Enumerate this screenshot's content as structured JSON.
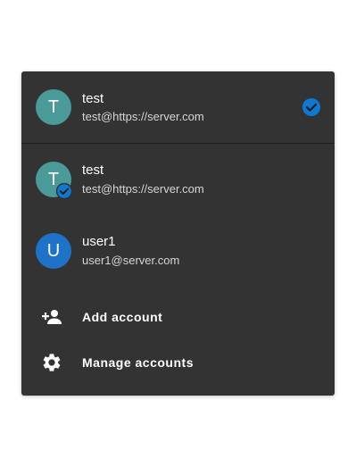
{
  "colors": {
    "panel_bg": "#333333",
    "accent": "#0d7ad1",
    "avatar_test": "#4a9a9a",
    "avatar_user1": "#1e73c9"
  },
  "current_account": {
    "initial": "T",
    "name": "test",
    "email": "test@https://server.com",
    "selected_icon": "check-circle-icon"
  },
  "accounts": [
    {
      "initial": "T",
      "name": "test",
      "email": "test@https://server.com",
      "badge_icon": "check-circle-icon"
    },
    {
      "initial": "U",
      "name": "user1",
      "email": "user1@server.com"
    }
  ],
  "actions": {
    "add_account": {
      "label": "Add account",
      "icon": "person-add-icon"
    },
    "manage_accounts": {
      "label": "Manage accounts",
      "icon": "gear-icon"
    }
  }
}
